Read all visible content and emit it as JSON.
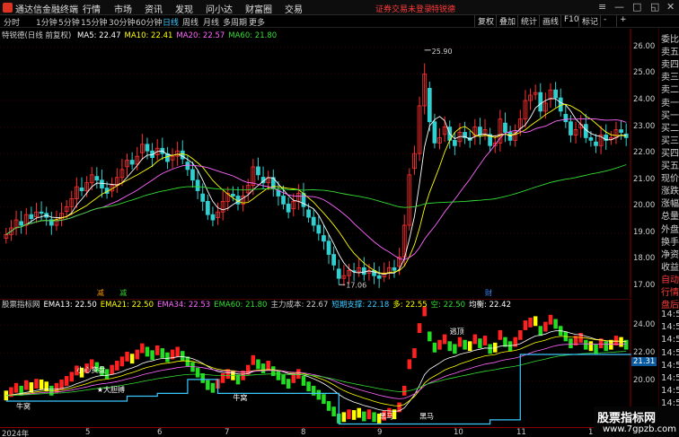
{
  "app": {
    "title": "通达信金融终端"
  },
  "menu": [
    "行情",
    "市场",
    "资讯",
    "发现",
    "问小达",
    "财富圈",
    "交易"
  ],
  "status": {
    "login": "证券交易未登录",
    "extra": "特锐德"
  },
  "periods": [
    "分时",
    "1分钟",
    "5分钟",
    "15分钟",
    "30分钟",
    "60分钟",
    "日线",
    "周线",
    "月线",
    "多周期",
    "更多"
  ],
  "active_period": "日线",
  "toolbar": [
    "复权",
    "叠加",
    "统计",
    "画线",
    "F10",
    "标记",
    "-",
    "+"
  ],
  "chart_title": "特锐德(日线 前复权)",
  "ma_legend": [
    {
      "label": "MA5: 22.47",
      "color": "#ffffff"
    },
    {
      "label": "MA10: 22.41",
      "color": "#ffff00"
    },
    {
      "label": "MA20: 22.57",
      "color": "#ff66ff"
    },
    {
      "label": "MA60: 21.80",
      "color": "#33dd33"
    }
  ],
  "indicator_legend": [
    {
      "label": "股票指标网",
      "color": "#cfcfcf"
    },
    {
      "label": "EMA13: 22.50",
      "color": "#ffffff"
    },
    {
      "label": "EMA21: 22.50",
      "color": "#ffff00"
    },
    {
      "label": "EMA34: 22.53",
      "color": "#ff66ff"
    },
    {
      "label": "EMA60: 21.80",
      "color": "#33dd33"
    },
    {
      "label": "主力成本: 22.67",
      "color": "#cfcfcf"
    },
    {
      "label": "短期支撑: 22.18",
      "color": "#3ac8ff"
    },
    {
      "label": "多: 22.55",
      "color": "#ffff00"
    },
    {
      "label": "空: 22.50",
      "color": "#33dd33"
    },
    {
      "label": "均衡: 22.42",
      "color": "#ffffff"
    }
  ],
  "price_axis": [
    "26.00",
    "25.00",
    "24.00",
    "23.00",
    "22.00",
    "21.00",
    "20.00",
    "19.00",
    "18.00",
    "17.00"
  ],
  "ind_axis": [
    "24.00",
    "22.00",
    "20.00"
  ],
  "ind_current": "21.31",
  "annotations": {
    "high": "25.90",
    "low": "17.06",
    "m1": "减",
    "m2": "减",
    "m3": "财",
    "ind_labels": [
      "小心资盘",
      "★大胆搏",
      "牛窝",
      "牛窝",
      "逃顶",
      "黑马",
      "黑马"
    ]
  },
  "right_panel": [
    "委比",
    "卖五",
    "卖四",
    "卖三",
    "卖二",
    "卖一",
    "买一",
    "买二",
    "买三",
    "买四",
    "买五",
    "现价",
    "涨跌",
    "涨幅",
    "总量",
    "外盘",
    "换手",
    "净资",
    "收益",
    "自动",
    "行情",
    "盘后",
    "14:50",
    "14:50",
    "14:50",
    "14:50",
    "14:50",
    "14:50",
    "14:50",
    "14:56"
  ],
  "time_axis": [
    "2024年",
    "5",
    "6",
    "7",
    "8",
    "9",
    "10",
    "11",
    "12"
  ],
  "watermark": {
    "line1": "股票指标网",
    "line2": "www.7gpzb.com"
  },
  "chart_data": {
    "type": "candlestick",
    "ylim": [
      16.9,
      26.3
    ],
    "ma": {
      "MA5": 22.47,
      "MA10": 22.41,
      "MA20": 22.57,
      "MA60": 21.8
    },
    "series_close": [
      18.95,
      19.2,
      19.5,
      19.3,
      19.7,
      19.55,
      19.8,
      19.75,
      19.6,
      19.3,
      19.5,
      19.75,
      20.0,
      20.3,
      20.75,
      20.6,
      20.9,
      21.2,
      21.0,
      20.7,
      20.5,
      20.8,
      21.1,
      21.4,
      21.75,
      21.6,
      21.9,
      22.35,
      22.1,
      21.85,
      22.2,
      22.0,
      21.7,
      21.9,
      22.1,
      21.8,
      21.4,
      21.0,
      20.6,
      20.2,
      19.7,
      19.5,
      19.8,
      20.2,
      20.5,
      20.4,
      20.1,
      20.4,
      20.8,
      21.5,
      21.2,
      20.9,
      21.1,
      20.7,
      20.4,
      20.1,
      19.8,
      20.2,
      20.5,
      20.0,
      19.6,
      19.3,
      19.0,
      18.7,
      18.2,
      17.8,
      17.3,
      17.4,
      17.6,
      17.55,
      17.7,
      17.45,
      17.6,
      17.4,
      17.3,
      17.5,
      17.7,
      17.6,
      18.1,
      19.3,
      21.2,
      22.0,
      23.8,
      25.0,
      23.2,
      22.4,
      22.6,
      23.0,
      22.5,
      22.3,
      22.8,
      22.6,
      22.5,
      23.0,
      22.7,
      22.9,
      22.3,
      22.4,
      23.3,
      22.8,
      22.5,
      22.8,
      23.3,
      24.0,
      24.2,
      24.3,
      23.6,
      23.9,
      24.4,
      24.1,
      23.6,
      23.2,
      22.7,
      22.9,
      23.1,
      22.6,
      22.5,
      22.3,
      22.7,
      22.5,
      22.6,
      22.9,
      22.8,
      22.6
    ]
  }
}
